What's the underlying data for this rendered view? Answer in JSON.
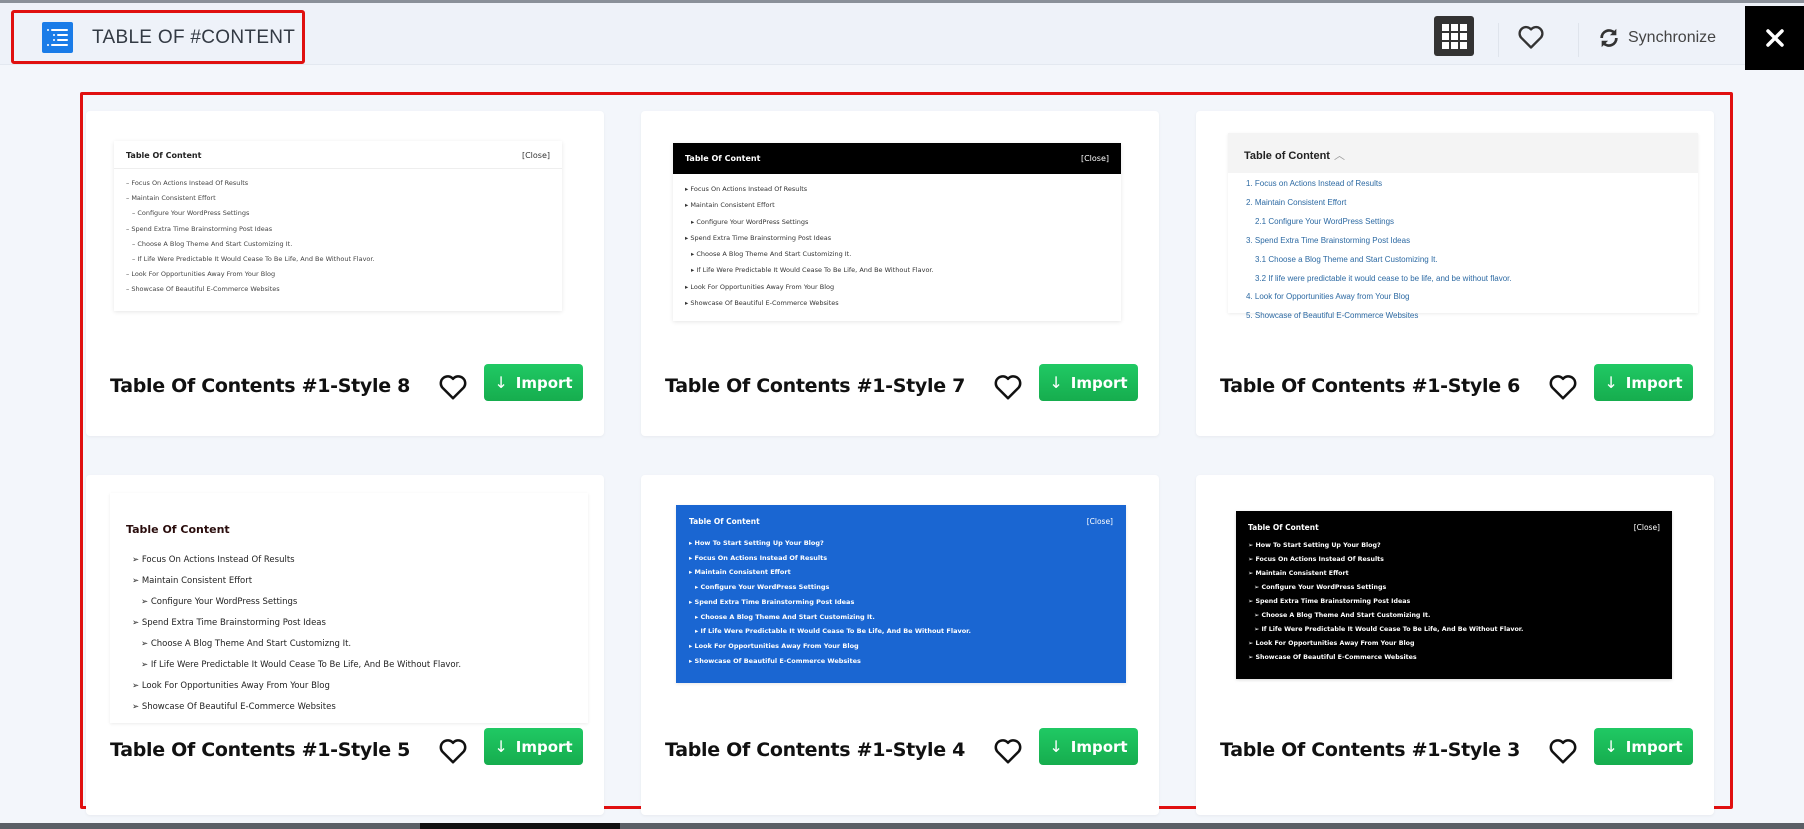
{
  "header": {
    "brand_title": "TABLE OF #CONTENT",
    "brand_icon": "table-of-contents-icon",
    "view_toggle": {
      "large_grid_icon": "grid-2x2-icon",
      "small_grid_icon": "grid-3x3-icon",
      "active": "grid-3x3"
    },
    "favorites_icon": "heart-icon",
    "sync_label": "Synchronize",
    "sync_icon": "sync-icon",
    "close_icon": "close-icon"
  },
  "colors": {
    "accent_red": "#e01010",
    "import_green": "#1bbb59",
    "brand_blue": "#1a7ce8",
    "preview_blue": "#1a66d2"
  },
  "card_actions": {
    "import_label": "Import",
    "import_icon": "arrow-down-icon",
    "favorite_icon": "heart-icon"
  },
  "templates": [
    {
      "title": "Table Of Contents #1-Style 8",
      "preview": {
        "heading": "Table Of Content",
        "close_label": "[Close]",
        "bullet": "–",
        "items": [
          {
            "text": "Focus On Actions Instead Of Results",
            "level": 1
          },
          {
            "text": "Maintain Consistent Effort",
            "level": 1
          },
          {
            "text": "Configure Your WordPress Settings",
            "level": 2
          },
          {
            "text": "Spend Extra Time Brainstorming Post Ideas",
            "level": 1
          },
          {
            "text": "Choose A Blog Theme And Start Customizing It.",
            "level": 2
          },
          {
            "text": "If Life Were Predictable It Would Cease To Be Life, And Be Without Flavor.",
            "level": 2
          },
          {
            "text": "Look For Opportunities Away From Your Blog",
            "level": 1
          },
          {
            "text": "Showcase Of Beautiful E-Commerce Websites",
            "level": 1
          }
        ]
      }
    },
    {
      "title": "Table Of Contents #1-Style 7",
      "preview": {
        "heading": "Table Of Content",
        "close_label": "[Close]",
        "bullet": "▸",
        "items": [
          {
            "text": "Focus On Actions Instead Of Results",
            "level": 1
          },
          {
            "text": "Maintain Consistent Effort",
            "level": 1
          },
          {
            "text": "Configure Your WordPress Settings",
            "level": 2
          },
          {
            "text": "Spend Extra Time Brainstorming Post Ideas",
            "level": 1
          },
          {
            "text": "Choose A Blog Theme And Start Customizing It.",
            "level": 2
          },
          {
            "text": "If Life Were Predictable It Would Cease To Be Life, And Be Without Flavor.",
            "level": 2
          },
          {
            "text": "Look For Opportunities Away From Your Blog",
            "level": 1
          },
          {
            "text": "Showcase Of Beautiful E-Commerce Websites",
            "level": 1
          }
        ]
      }
    },
    {
      "title": "Table Of Contents #1-Style 6",
      "preview": {
        "heading": "Table of Content",
        "toggle_icon": "chevron-up-icon",
        "items": [
          {
            "num": "1.",
            "text": "Focus on Actions Instead of Results",
            "level": 1
          },
          {
            "num": "2.",
            "text": "Maintain Consistent Effort",
            "level": 1
          },
          {
            "num": "2.1",
            "text": "Configure Your WordPress Settings",
            "level": 2
          },
          {
            "num": "3.",
            "text": "Spend Extra Time Brainstorming Post Ideas",
            "level": 1
          },
          {
            "num": "3.1",
            "text": "Choose a Blog Theme and Start Customizing It.",
            "level": 2
          },
          {
            "num": "3.2",
            "text": "If life were predictable it would cease to be life, and be without flavor.",
            "level": 2
          },
          {
            "num": "4.",
            "text": "Look for Opportunities Away from Your Blog",
            "level": 1
          },
          {
            "num": "5.",
            "text": "Showcase of Beautiful E-Commerce Websites",
            "level": 1
          }
        ]
      }
    },
    {
      "title": "Table Of Contents #1-Style 5",
      "preview": {
        "heading": "Table Of Content",
        "bullet": "➢",
        "items": [
          {
            "text": "Focus On Actions Instead Of Results",
            "level": 1
          },
          {
            "text": "Maintain Consistent Effort",
            "level": 1
          },
          {
            "text": "Configure Your WordPress Settings",
            "level": 2
          },
          {
            "text": "Spend Extra Time Brainstorming Post Ideas",
            "level": 1
          },
          {
            "text": "Choose A Blog Theme And Start Customizng It.",
            "level": 2
          },
          {
            "text": "If Life Were Predictable It Would Cease To Be Life, And Be Without Flavor.",
            "level": 2
          },
          {
            "text": "Look For Opportunities Away From Your Blog",
            "level": 1
          },
          {
            "text": "Showcase Of Beautiful E-Commerce Websites",
            "level": 1
          }
        ]
      }
    },
    {
      "title": "Table Of Contents #1-Style 4",
      "preview": {
        "heading": "Table Of Content",
        "close_label": "[Close]",
        "bullet": "▸",
        "items": [
          {
            "text": "How To Start Setting Up Your Blog?",
            "level": 1
          },
          {
            "text": "Focus On Actions Instead Of Results",
            "level": 1
          },
          {
            "text": "Maintain Consistent Effort",
            "level": 1
          },
          {
            "text": "Configure Your WordPress Settings",
            "level": 2
          },
          {
            "text": "Spend Extra Time Brainstorming Post Ideas",
            "level": 1
          },
          {
            "text": "Choose A Blog Theme And Start Customizing It.",
            "level": 2
          },
          {
            "text": "If Life Were Predictable It Would Cease To Be Life, And Be Without Flavor.",
            "level": 2
          },
          {
            "text": "Look For Opportunities Away From Your Blog",
            "level": 1
          },
          {
            "text": "Showcase Of Beautiful E-Commerce Websites",
            "level": 1
          }
        ]
      }
    },
    {
      "title": "Table Of Contents #1-Style 3",
      "preview": {
        "heading": "Table Of Content",
        "close_label": "[Close]",
        "bullet": "➢",
        "items": [
          {
            "text": "How To Start Setting Up Your Blog?",
            "level": 1
          },
          {
            "text": "Focus On Actions Instead Of Results",
            "level": 1
          },
          {
            "text": "Maintain Consistent Effort",
            "level": 1
          },
          {
            "text": "Configure Your WordPress Settings",
            "level": 2
          },
          {
            "text": "Spend Extra Time Brainstorming Post Ideas",
            "level": 1
          },
          {
            "text": "Choose A Blog Theme And Start Customizing It.",
            "level": 2
          },
          {
            "text": "If Life Were Predictable It Would Cease To Be Life, And Be Without Flavor.",
            "level": 2
          },
          {
            "text": "Look For Opportunities Away From Your Blog",
            "level": 1
          },
          {
            "text": "Showcase Of Beautiful E-Commerce Websites",
            "level": 1
          }
        ]
      }
    }
  ]
}
